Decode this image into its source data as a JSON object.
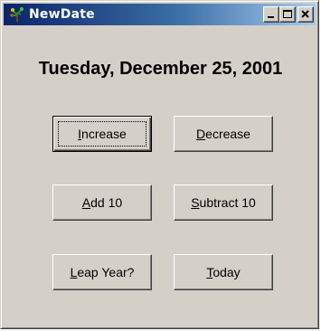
{
  "window": {
    "title": "NewDate",
    "app_icon": "tree-icon",
    "controls": [
      "minimize-icon",
      "maximize-icon",
      "close-icon"
    ]
  },
  "date_display": "Tuesday, December 25, 2001",
  "buttons": {
    "increase": {
      "mnemonic": "I",
      "rest": "ncrease",
      "label": "Increase"
    },
    "decrease": {
      "mnemonic": "D",
      "rest": "ecrease",
      "label": "Decrease"
    },
    "add10": {
      "mnemonic": "A",
      "rest": "dd 10",
      "label": "Add 10"
    },
    "subtract10": {
      "mnemonic": "S",
      "rest": "ubtract 10",
      "label": "Subtract 10"
    },
    "leapyear": {
      "mnemonic": "L",
      "rest": "eap Year?",
      "label": "Leap Year?"
    },
    "today": {
      "mnemonic": "T",
      "rest": "oday",
      "label": "Today"
    }
  },
  "colors": {
    "face": "#d4d0c8",
    "title_start": "#0a246a",
    "title_end": "#a6caf0"
  }
}
